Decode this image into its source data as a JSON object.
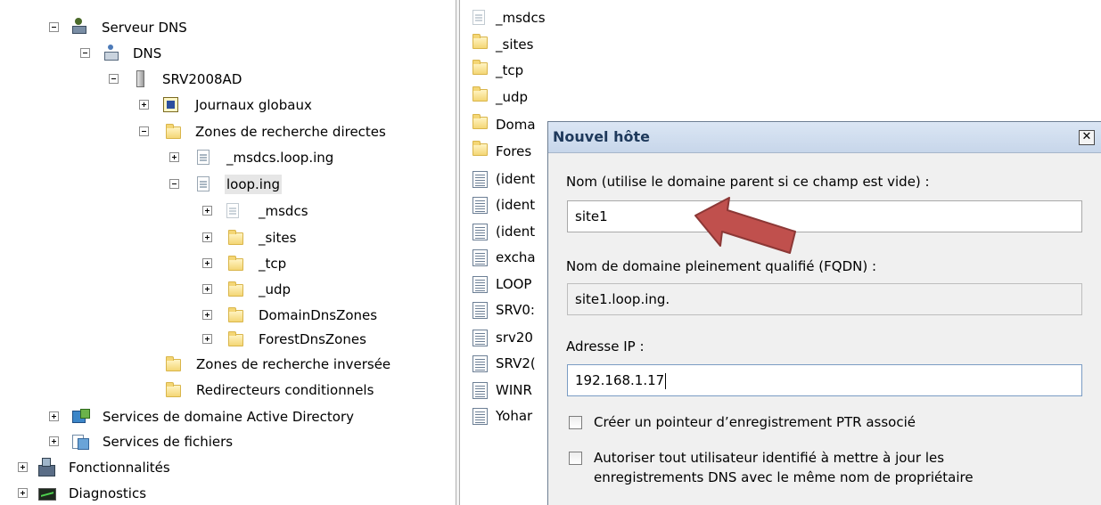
{
  "tree": {
    "items": [
      {
        "label": "Serveur DNS",
        "expander": "minus"
      },
      {
        "label": "DNS",
        "expander": "minus"
      },
      {
        "label": "SRV2008AD",
        "expander": "minus"
      },
      {
        "label": "Journaux globaux",
        "expander": "plus"
      },
      {
        "label": "Zones de recherche directes",
        "expander": "minus"
      },
      {
        "label": "_msdcs.loop.ing",
        "expander": "plus"
      },
      {
        "label": "loop.ing",
        "expander": "minus",
        "selected": true
      },
      {
        "label": "_msdcs",
        "expander": "plus"
      },
      {
        "label": "_sites",
        "expander": "plus"
      },
      {
        "label": "_tcp",
        "expander": "plus"
      },
      {
        "label": "_udp",
        "expander": "plus"
      },
      {
        "label": "DomainDnsZones",
        "expander": "plus"
      },
      {
        "label": "ForestDnsZones",
        "expander": "plus"
      },
      {
        "label": "Zones de recherche inversée",
        "expander": "none"
      },
      {
        "label": "Redirecteurs conditionnels",
        "expander": "none"
      },
      {
        "label": "Services de domaine Active Directory",
        "expander": "plus"
      },
      {
        "label": "Services de fichiers",
        "expander": "plus"
      },
      {
        "label": "Fonctionnalités",
        "expander": "plus"
      },
      {
        "label": "Diagnostics",
        "expander": "plus"
      }
    ]
  },
  "list": {
    "items": [
      {
        "label": "_msdcs",
        "icon": "zone-icon"
      },
      {
        "label": "_sites",
        "icon": "folder-icon"
      },
      {
        "label": "_tcp",
        "icon": "folder-icon"
      },
      {
        "label": "_udp",
        "icon": "folder-icon"
      },
      {
        "label": "Doma",
        "icon": "folder-icon"
      },
      {
        "label": "Fores",
        "icon": "folder-icon"
      },
      {
        "label": "(ident",
        "icon": "record-icon"
      },
      {
        "label": "(ident",
        "icon": "record-icon"
      },
      {
        "label": "(ident",
        "icon": "record-icon"
      },
      {
        "label": "excha",
        "icon": "record-icon"
      },
      {
        "label": "LOOP",
        "icon": "record-icon"
      },
      {
        "label": "SRV0:",
        "icon": "record-icon"
      },
      {
        "label": "srv20",
        "icon": "record-icon"
      },
      {
        "label": "SRV2(",
        "icon": "record-icon"
      },
      {
        "label": "WINR",
        "icon": "record-icon"
      },
      {
        "label": "Yohar",
        "icon": "record-icon"
      }
    ]
  },
  "dialog": {
    "title": "Nouvel hôte",
    "close": "✕",
    "name_label": "Nom (utilise le domaine parent si ce champ est vide) :",
    "name_value": "site1",
    "fqdn_label": "Nom de domaine pleinement qualifié (FQDN) :",
    "fqdn_value": "site1.loop.ing.",
    "ip_label": "Adresse IP :",
    "ip_value": "192.168.1.17",
    "ptr_label": "Créer un pointeur d’enregistrement PTR associé",
    "auth_label_line1": "Autoriser tout utilisateur identifié à mettre à jour les",
    "auth_label_line2": "enregistrements DNS avec le même nom de propriétaire"
  },
  "colors": {
    "arrow_fill": "#c0504d",
    "arrow_stroke": "#8c3836",
    "dialog_title": "#1e395b"
  }
}
